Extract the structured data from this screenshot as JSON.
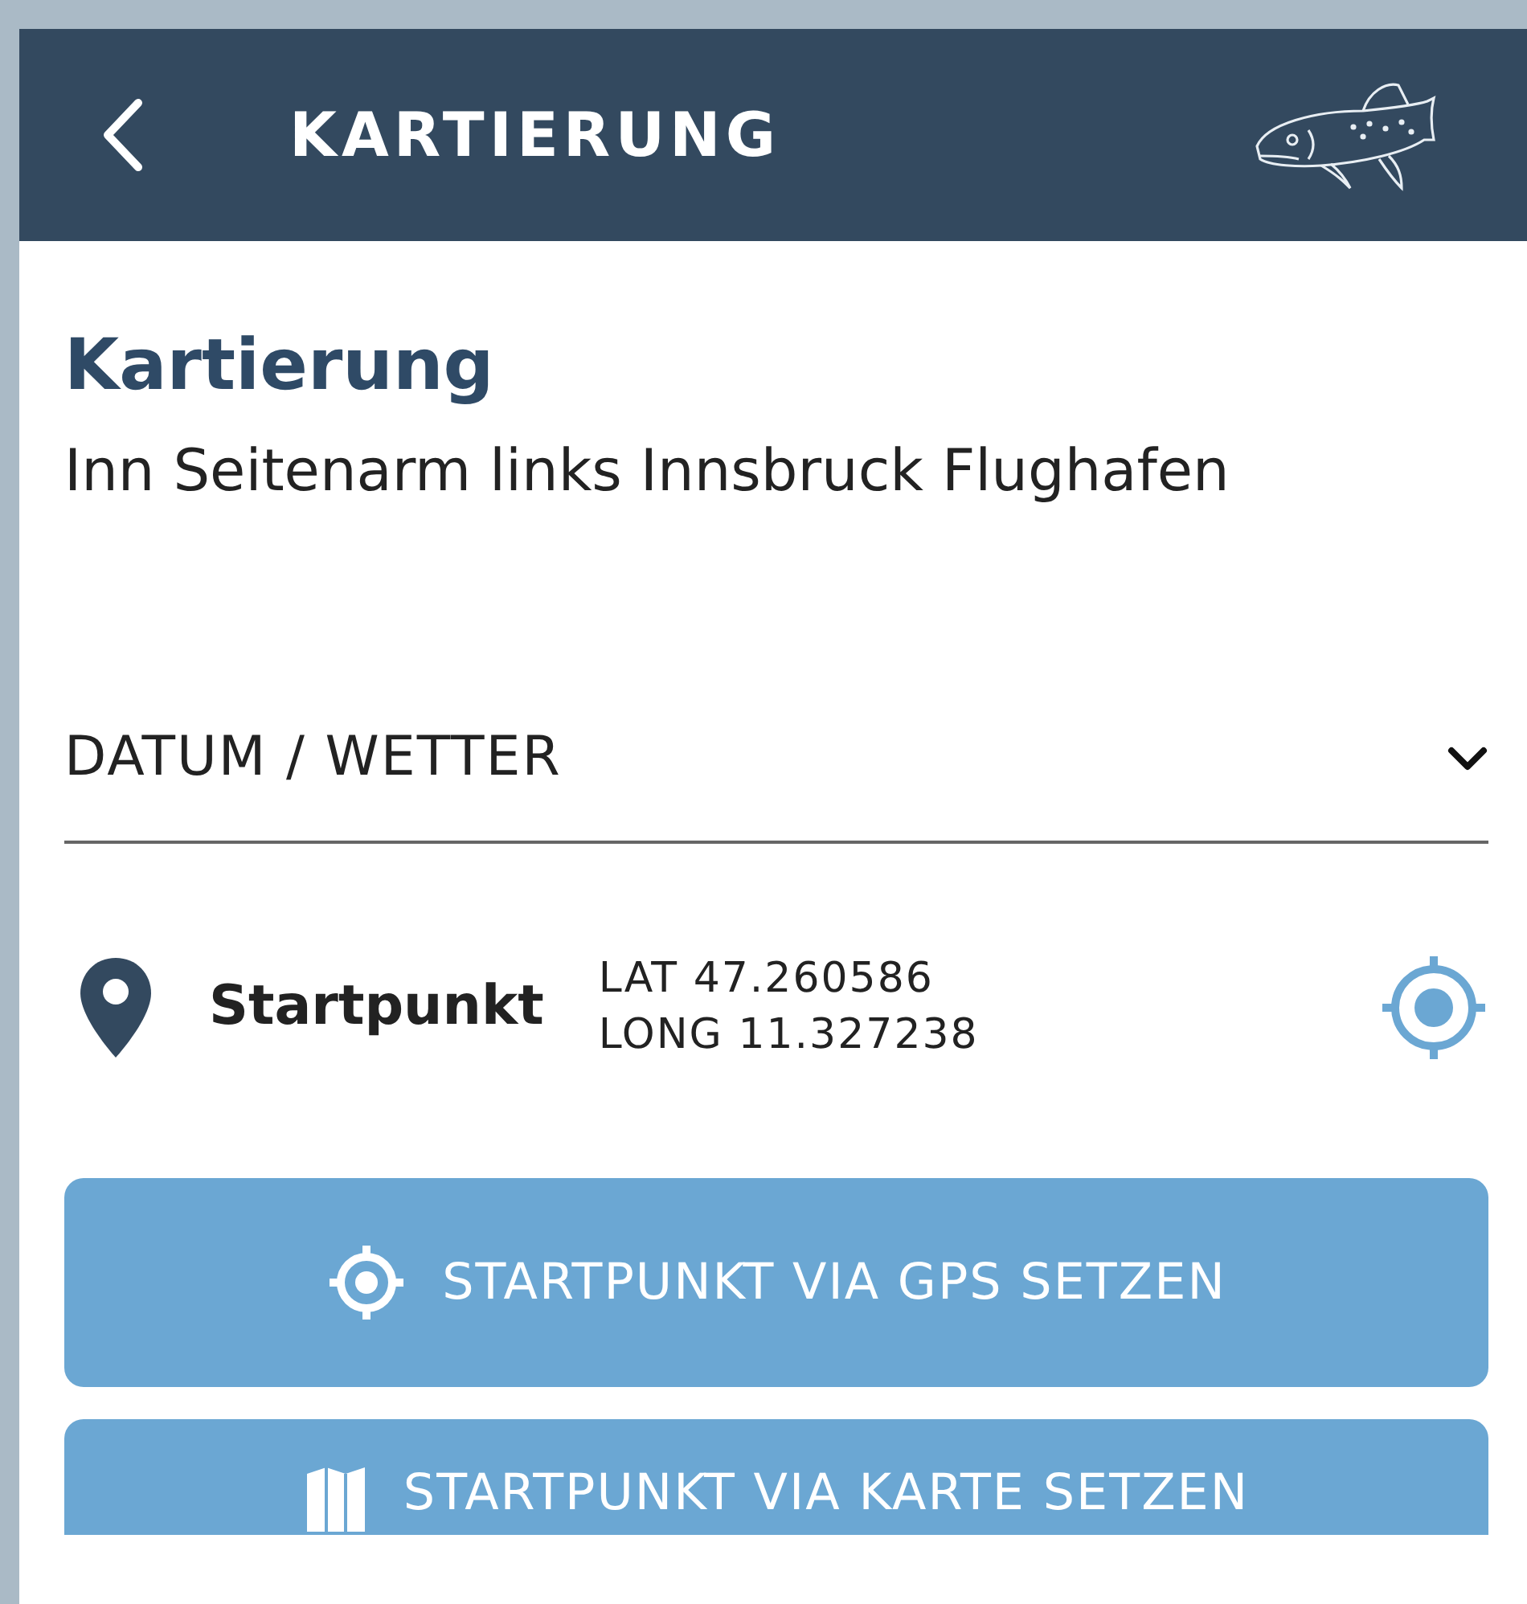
{
  "header": {
    "title": "KARTIERUNG"
  },
  "page": {
    "title": "Kartierung",
    "subtitle": "Inn Seitenarm links Innsbruck Flughafen"
  },
  "accordion": {
    "label": "DATUM / WETTER",
    "expanded": false
  },
  "startpoint": {
    "label": "Startpunkt",
    "lat": "LAT 47.260586",
    "long": "LONG 11.327238"
  },
  "buttons": [
    {
      "kind": "gps",
      "label": "STARTPUNKT VIA GPS SETZEN"
    },
    {
      "kind": "map",
      "label": "STARTPUNKT VIA KARTE SETZEN"
    }
  ]
}
